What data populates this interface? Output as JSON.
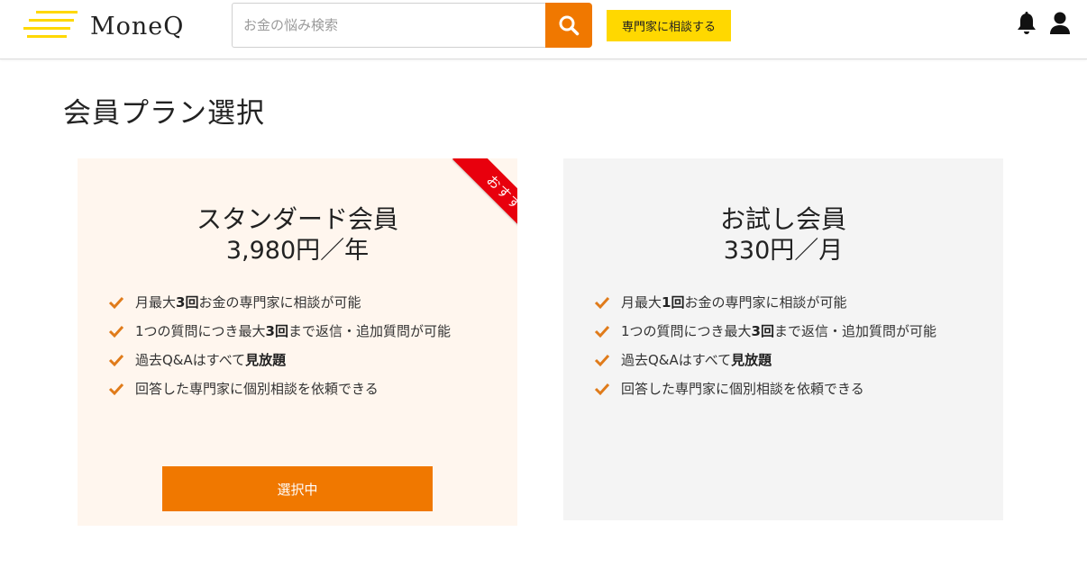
{
  "header": {
    "logo_text": "MoneQ",
    "search_placeholder": "お金の悩み検索",
    "search_icon": "search-icon",
    "consult_label": "専門家に相談する",
    "bell_icon": "bell-icon",
    "user_icon": "user-icon"
  },
  "colors": {
    "accent_orange": "#f07800",
    "yellow": "#ffd800",
    "ribbon_red": "#e8000d",
    "standard_bg": "#fff6ee",
    "trial_bg": "#f4f4f4"
  },
  "page": {
    "title": "会員プラン選択"
  },
  "plans": [
    {
      "name": "スタンダード会員",
      "price": "3,980円／年",
      "ribbon": "おすすめ",
      "button_label": "選択中",
      "features": [
        {
          "pre": "月最大",
          "bold": "3回",
          "post": "お金の専門家に相談が可能"
        },
        {
          "pre": "1つの質問につき最大",
          "bold": "3回",
          "post": "まで返信・追加質問が可能"
        },
        {
          "pre": "過去Q&Aはすべて",
          "bold": "見放題",
          "post": ""
        },
        {
          "pre": "回答した専門家に個別相談を依頼できる",
          "bold": "",
          "post": ""
        }
      ]
    },
    {
      "name": "お試し会員",
      "price": "330円／月",
      "features": [
        {
          "pre": "月最大",
          "bold": "1回",
          "post": "お金の専門家に相談が可能"
        },
        {
          "pre": "1つの質問につき最大",
          "bold": "3回",
          "post": "まで返信・追加質問が可能"
        },
        {
          "pre": "過去Q&Aはすべて",
          "bold": "見放題",
          "post": ""
        },
        {
          "pre": "回答した専門家に個別相談を依頼できる",
          "bold": "",
          "post": ""
        }
      ]
    }
  ]
}
